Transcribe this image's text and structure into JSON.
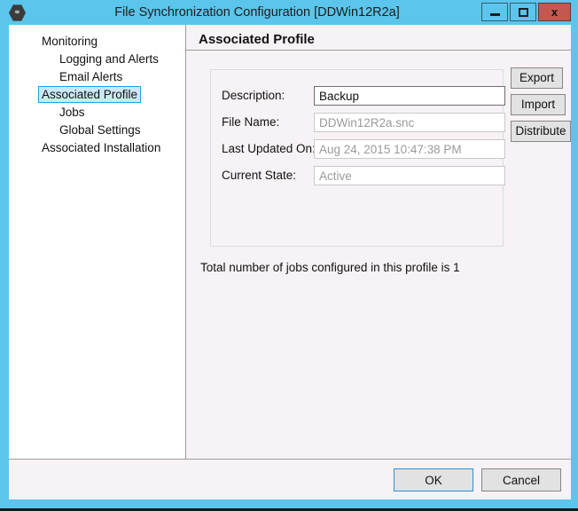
{
  "window": {
    "title": "File Synchronization Configuration [DDWin12R2a]",
    "icon": "app-hex-icon",
    "frame_color": "#5BC5EC",
    "close_color": "#C4584F",
    "caption_buttons": {
      "minimize": "minimize-icon",
      "maximize": "maximize-icon",
      "close": "x"
    }
  },
  "sidebar": {
    "items": [
      {
        "label": "Monitoring",
        "level": 0,
        "expandable": true,
        "selected": false
      },
      {
        "label": "Logging and Alerts",
        "level": 1,
        "expandable": false,
        "selected": false
      },
      {
        "label": "Email Alerts",
        "level": 1,
        "expandable": false,
        "selected": false
      },
      {
        "label": "Associated Profile",
        "level": 0,
        "expandable": true,
        "selected": true
      },
      {
        "label": "Jobs",
        "level": 1,
        "expandable": false,
        "selected": false
      },
      {
        "label": "Global Settings",
        "level": 1,
        "expandable": false,
        "selected": false
      },
      {
        "label": "Associated Installation",
        "level": 0,
        "expandable": false,
        "selected": false
      }
    ],
    "selection_fill": "#CBE8F6",
    "selection_border": "#26A0DA"
  },
  "main": {
    "page_title": "Associated Profile",
    "fields": [
      {
        "label": "Description:",
        "value": "Backup",
        "readonly": false
      },
      {
        "label": "File Name:",
        "value": "DDWin12R2a.snc",
        "readonly": true
      },
      {
        "label": "Last Updated On:",
        "value": "Aug 24, 2015 10:47:38 PM",
        "readonly": true
      },
      {
        "label": "Current State:",
        "value": "Active",
        "readonly": true
      }
    ],
    "side_buttons": {
      "export": "Export",
      "import": "Import",
      "distribute": "Distribute"
    },
    "jobs_note": "Total number of jobs configured in this profile is 1"
  },
  "footer": {
    "ok": "OK",
    "cancel": "Cancel",
    "default_button_border": "#2E8FD4"
  }
}
